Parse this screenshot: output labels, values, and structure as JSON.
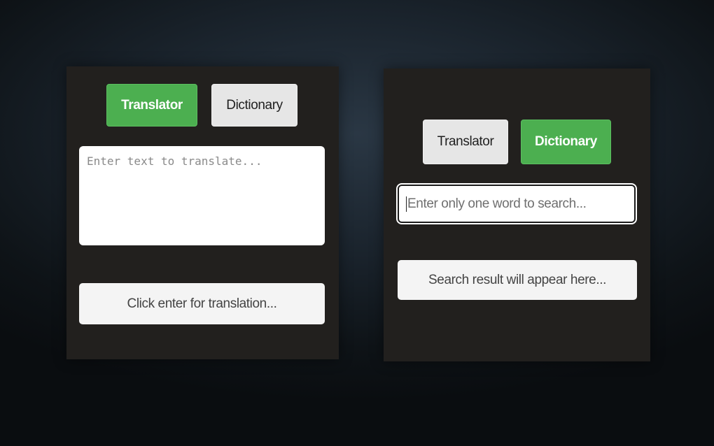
{
  "theme": {
    "accent": "#4caf50",
    "tab_inactive_bg": "#e6e6e6",
    "panel_bg": "#22201e"
  },
  "translator_panel": {
    "tabs": [
      {
        "label": "Translator",
        "active": true
      },
      {
        "label": "Dictionary",
        "active": false
      }
    ],
    "input": {
      "placeholder": "Enter text to translate...",
      "value": ""
    },
    "result": {
      "text": "Click enter for translation..."
    }
  },
  "dictionary_panel": {
    "tabs": [
      {
        "label": "Translator",
        "active": false
      },
      {
        "label": "Dictionary",
        "active": true
      }
    ],
    "input": {
      "placeholder": "Enter only one word to search...",
      "value": ""
    },
    "result": {
      "text": "Search result will appear here..."
    }
  }
}
